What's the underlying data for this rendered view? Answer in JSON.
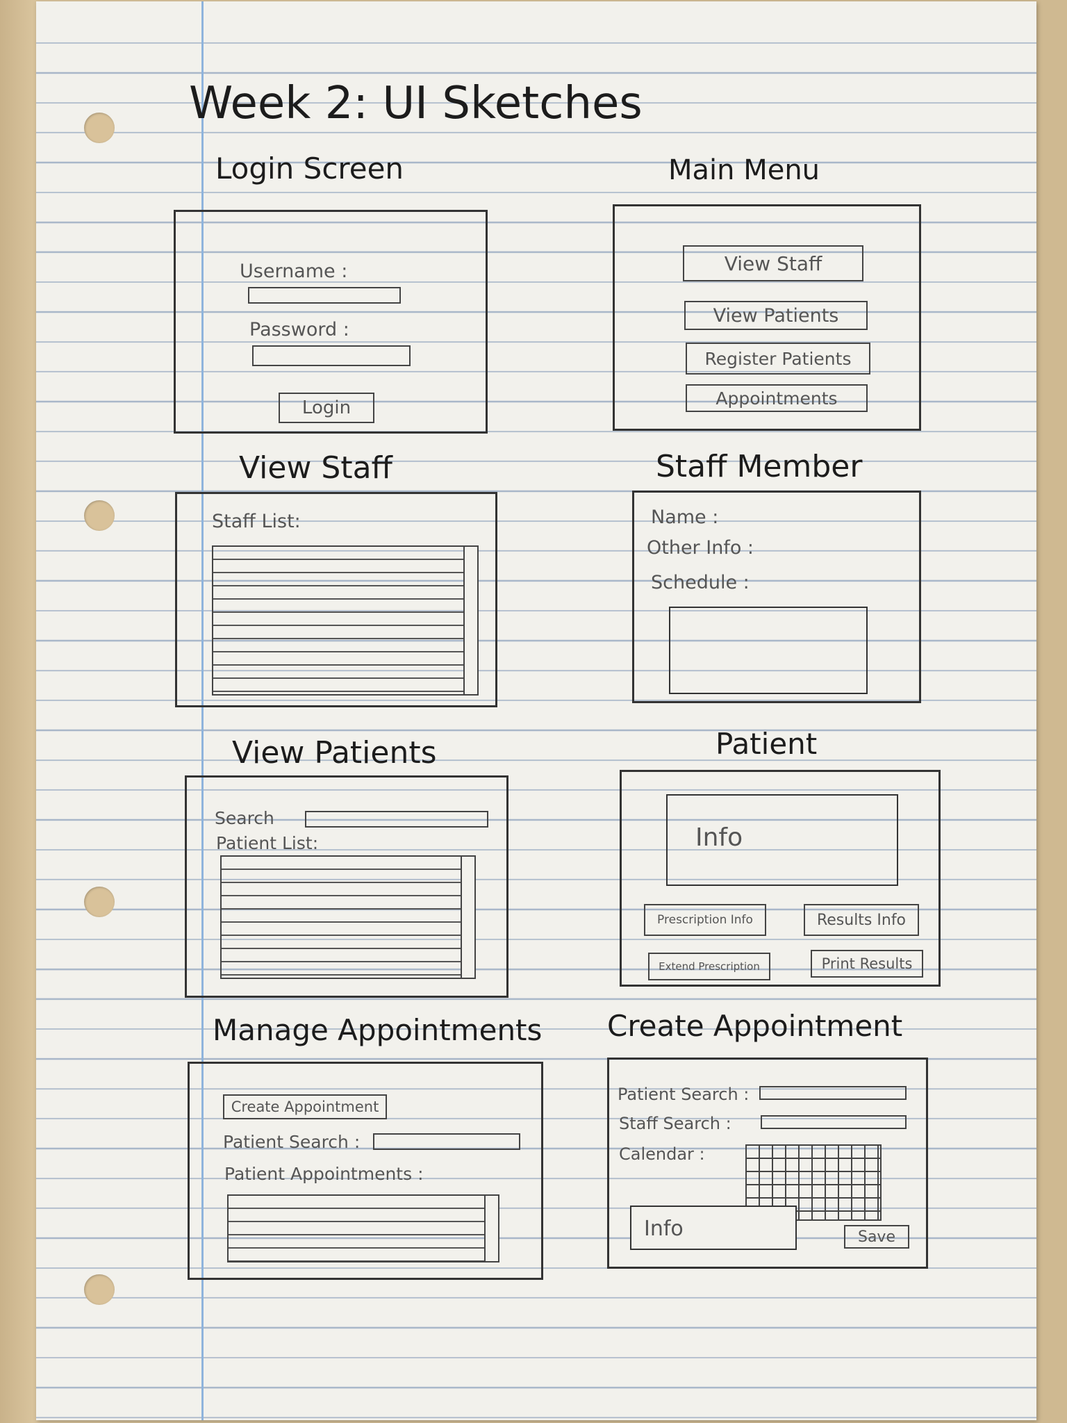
{
  "title": "Week 2: UI Sketches",
  "sketches": {
    "login": {
      "heading": "Login Screen",
      "username_label": "Username :",
      "password_label": "Password :",
      "login_button": "Login"
    },
    "main_menu": {
      "heading": "Main Menu",
      "buttons": [
        "View Staff",
        "View Patients",
        "Register Patients",
        "Appointments"
      ]
    },
    "view_staff": {
      "heading": "View Staff",
      "list_label": "Staff List:"
    },
    "staff_member": {
      "heading": "Staff Member",
      "name_label": "Name :",
      "other_info_label": "Other Info :",
      "schedule_label": "Schedule :"
    },
    "view_patients": {
      "heading": "View Patients",
      "search_label": "Search",
      "list_label": "Patient List:"
    },
    "patient": {
      "heading": "Patient",
      "info_label": "Info",
      "buttons": [
        "Prescription Info",
        "Results Info",
        "Extend Prescription",
        "Print Results"
      ]
    },
    "manage_appointments": {
      "heading": "Manage Appointments",
      "create_button": "Create Appointment",
      "patient_search_label": "Patient Search :",
      "appointments_label": "Patient Appointments :"
    },
    "create_appointment": {
      "heading": "Create Appointment",
      "patient_search_label": "Patient Search :",
      "staff_search_label": "Staff Search :",
      "calendar_label": "Calendar :",
      "info_label": "Info",
      "save_button": "Save"
    }
  }
}
